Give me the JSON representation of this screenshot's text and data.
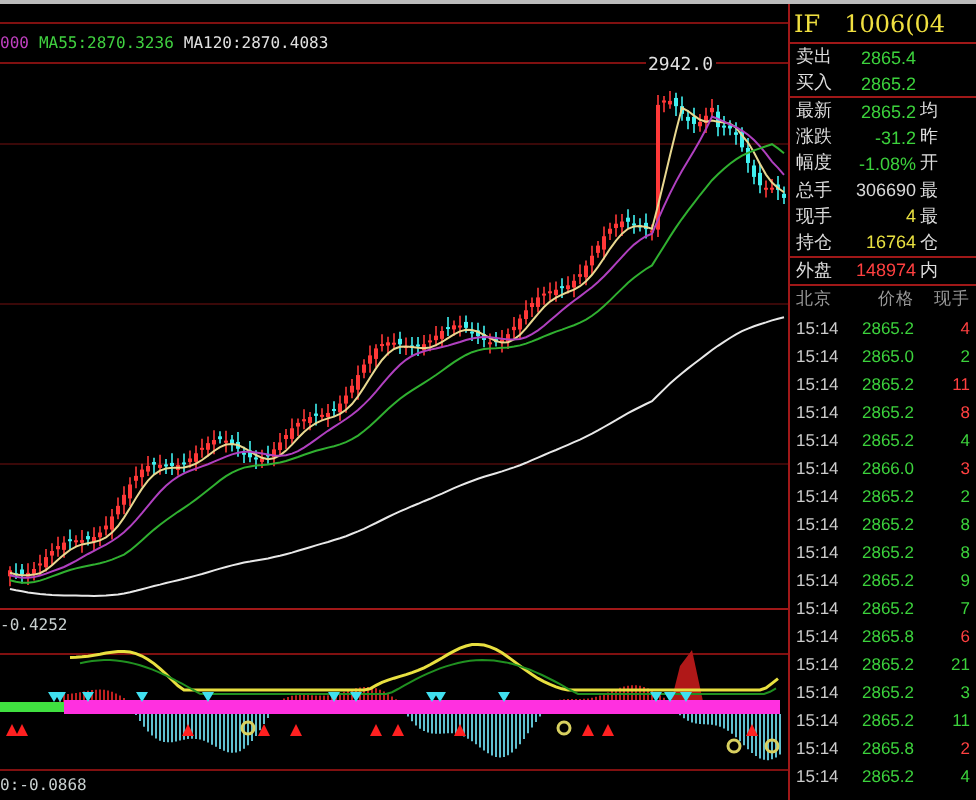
{
  "chart": {
    "legend": [
      {
        "text": "000",
        "color": "#c040c0"
      },
      {
        "text": "MA55:2870.3236",
        "color": "#40d040"
      },
      {
        "text": "MA120:2870.4083",
        "color": "#e0e0e0"
      }
    ],
    "peak_label": "2942.0"
  },
  "indicator": {
    "top_label": "-0.4252",
    "bottom_label": "0:-0.0868"
  },
  "quote": {
    "symbol": "IF",
    "contract": "1006(04",
    "rows": [
      {
        "label": "卖出",
        "value": "2865.4",
        "color": "#3cd23c"
      },
      {
        "label": "买入",
        "value": "2865.2",
        "color": "#3cd23c"
      },
      {
        "label": "最新",
        "value": "2865.2",
        "color": "#3cd23c",
        "extra": "均"
      },
      {
        "label": "涨跌",
        "value": "-31.2",
        "color": "#3cd23c",
        "extra": "昨"
      },
      {
        "label": "幅度",
        "value": "-1.08%",
        "color": "#3cd23c",
        "extra": "开"
      },
      {
        "label": "总手",
        "value": "306690",
        "color": "#d8d8d8",
        "extra": "最"
      },
      {
        "label": "现手",
        "value": "4",
        "color": "#e8e040",
        "extra": "最"
      },
      {
        "label": "持仓",
        "value": "16764",
        "color": "#e8e040",
        "extra": "仓"
      },
      {
        "label": "外盘",
        "value": "148974",
        "color": "#ff4040",
        "extra": "内"
      }
    ]
  },
  "ticks": {
    "columns": [
      "北京",
      "价格",
      "现手"
    ],
    "rows": [
      {
        "time": "15:14",
        "price": "2865.2",
        "volume": "4",
        "color": "#ff4040"
      },
      {
        "time": "15:14",
        "price": "2865.0",
        "volume": "2",
        "color": "#3cd23c"
      },
      {
        "time": "15:14",
        "price": "2865.2",
        "volume": "11",
        "color": "#ff4040"
      },
      {
        "time": "15:14",
        "price": "2865.2",
        "volume": "8",
        "color": "#ff4040"
      },
      {
        "time": "15:14",
        "price": "2865.2",
        "volume": "4",
        "color": "#3cd23c"
      },
      {
        "time": "15:14",
        "price": "2866.0",
        "volume": "3",
        "color": "#ff4040"
      },
      {
        "time": "15:14",
        "price": "2865.2",
        "volume": "2",
        "color": "#3cd23c"
      },
      {
        "time": "15:14",
        "price": "2865.2",
        "volume": "8",
        "color": "#3cd23c"
      },
      {
        "time": "15:14",
        "price": "2865.2",
        "volume": "8",
        "color": "#3cd23c"
      },
      {
        "time": "15:14",
        "price": "2865.2",
        "volume": "9",
        "color": "#3cd23c"
      },
      {
        "time": "15:14",
        "price": "2865.2",
        "volume": "7",
        "color": "#3cd23c"
      },
      {
        "time": "15:14",
        "price": "2865.8",
        "volume": "6",
        "color": "#ff4040"
      },
      {
        "time": "15:14",
        "price": "2865.2",
        "volume": "21",
        "color": "#3cd23c"
      },
      {
        "time": "15:14",
        "price": "2865.2",
        "volume": "3",
        "color": "#3cd23c"
      },
      {
        "time": "15:14",
        "price": "2865.2",
        "volume": "11",
        "color": "#3cd23c"
      },
      {
        "time": "15:14",
        "price": "2865.8",
        "volume": "2",
        "color": "#ff4040"
      },
      {
        "time": "15:14",
        "price": "2865.2",
        "volume": "4",
        "color": "#3cd23c"
      }
    ]
  }
}
